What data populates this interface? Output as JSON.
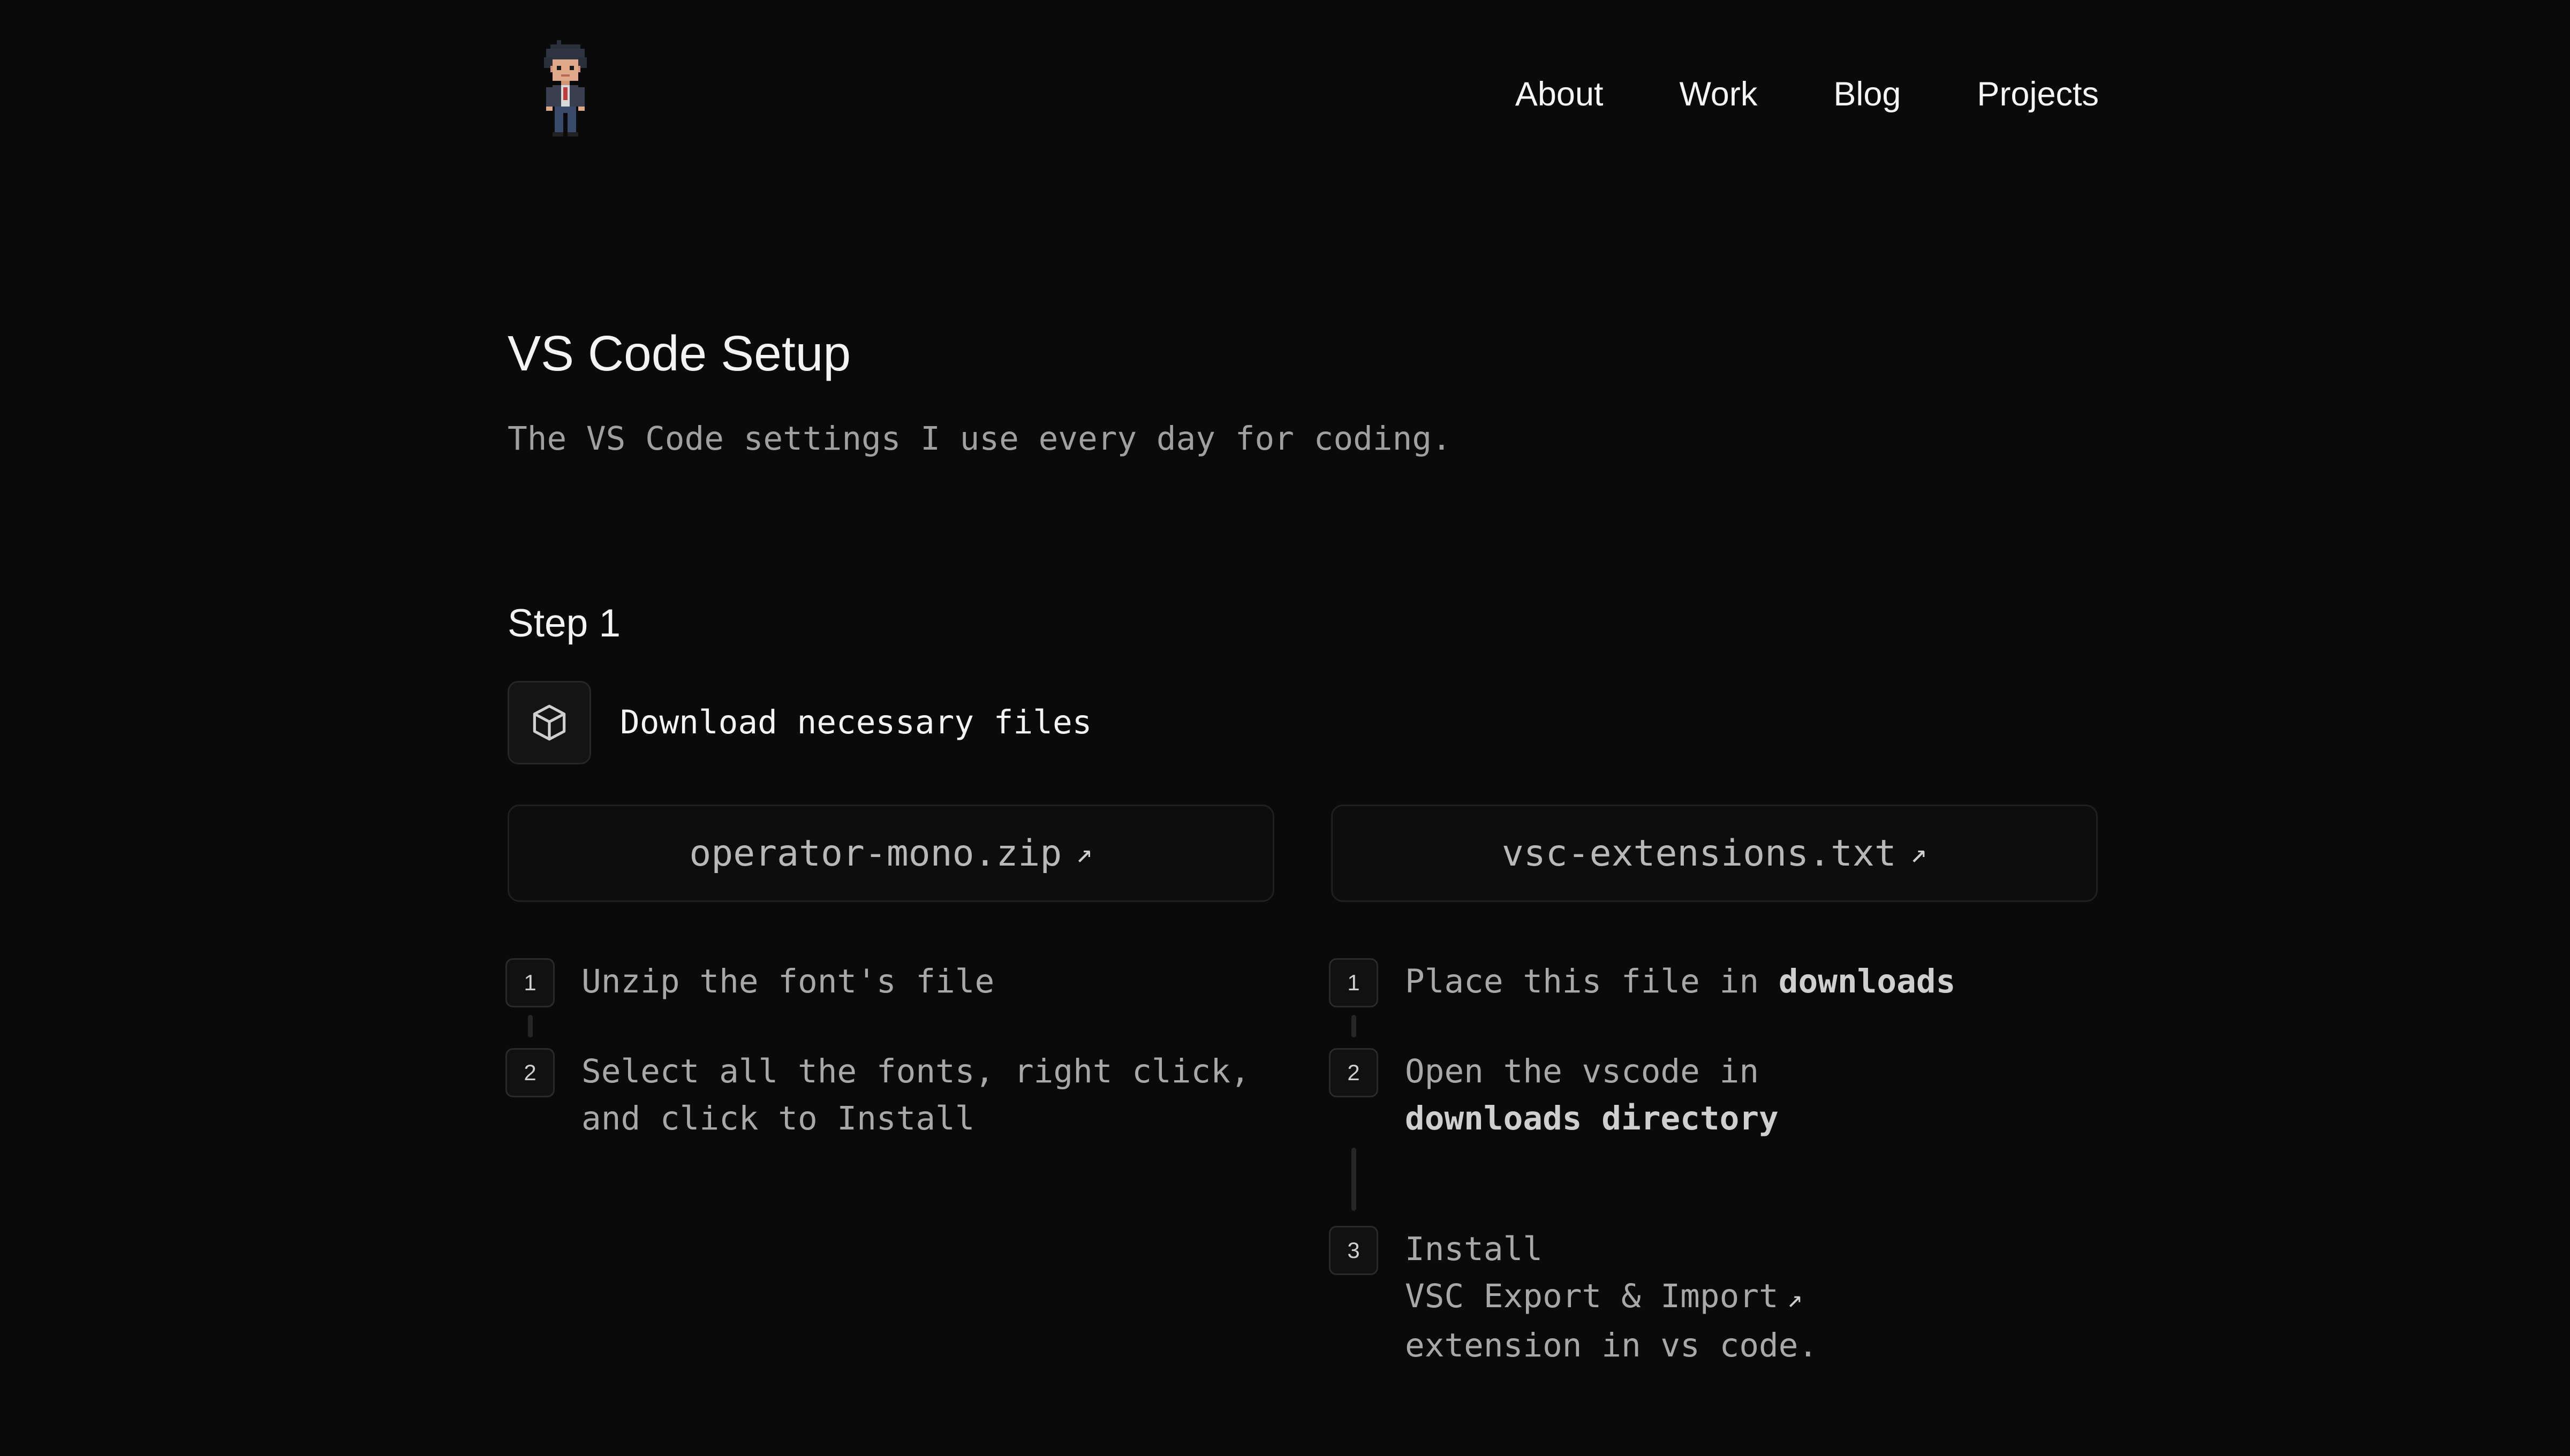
{
  "nav": {
    "items": [
      {
        "label": "About"
      },
      {
        "label": "Work"
      },
      {
        "label": "Blog"
      },
      {
        "label": "Projects"
      }
    ]
  },
  "page": {
    "title": "VS Code Setup",
    "subtitle": "The VS Code settings I use every day for coding."
  },
  "step": {
    "heading": "Step 1",
    "icon": "package-icon",
    "description": "Download necessary files"
  },
  "files": [
    {
      "name": "operator-mono.zip",
      "icon": "external-link-icon"
    },
    {
      "name": "vsc-extensions.txt",
      "icon": "external-link-icon"
    }
  ],
  "font_steps": [
    {
      "number": "1",
      "text": "Unzip the font's file"
    },
    {
      "number": "2",
      "text_line1": "Select all the fonts, right click,",
      "text_line2": "and click to Install"
    }
  ],
  "ext_steps": [
    {
      "number": "1",
      "text": "Place this file in ",
      "bold": "downloads"
    },
    {
      "number": "2",
      "text": "Open the vscode in",
      "bold": "downloads directory"
    },
    {
      "number": "3",
      "text": "Install",
      "link": "VSC Export & Import",
      "text_after": "extension in vs code."
    }
  ],
  "colors": {
    "background": "#0a0a0a",
    "text_primary": "#f3f3f3",
    "text_muted": "#a8a8a8",
    "border": "#262626"
  }
}
